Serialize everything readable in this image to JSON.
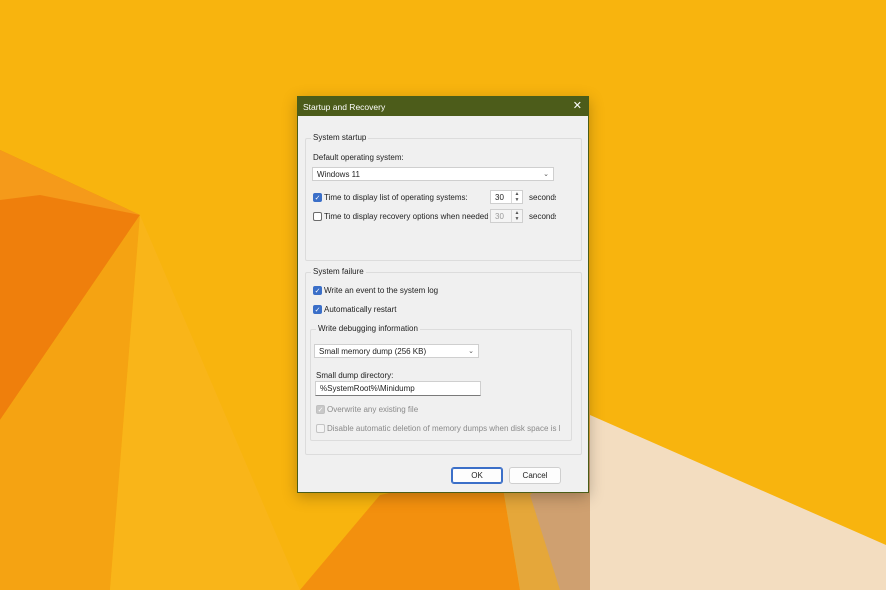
{
  "dialog": {
    "title": "Startup and Recovery",
    "close_glyph": "✕",
    "system_startup": {
      "group_label": "System startup",
      "default_os_label": "Default operating system:",
      "default_os_value": "Windows 11",
      "time_list": {
        "checked": true,
        "label": "Time to display list of operating systems:",
        "value": "30",
        "unit": "seconds"
      },
      "time_recovery": {
        "checked": false,
        "label": "Time to display recovery options when needed:",
        "value": "30",
        "unit": "seconds"
      }
    },
    "system_failure": {
      "group_label": "System failure",
      "write_event": {
        "checked": true,
        "label": "Write an event to the system log"
      },
      "auto_restart": {
        "checked": true,
        "label": "Automatically restart"
      },
      "debug": {
        "group_label": "Write debugging information",
        "dump_type": "Small memory dump (256 KB)",
        "dir_label": "Small dump directory:",
        "dir_value": "%SystemRoot%\\Minidump",
        "overwrite": {
          "checked": true,
          "enabled": false,
          "label": "Overwrite any existing file"
        },
        "disable_delete": {
          "checked": false,
          "enabled": false,
          "label": "Disable automatic deletion of memory dumps when disk space is l"
        }
      }
    },
    "ok_label": "OK",
    "cancel_label": "Cancel"
  },
  "colors": {
    "titlebar": "#4c5c1a",
    "checkbox_accent": "#3b6fc8",
    "wallpaper_yellow": "#f8b40e",
    "wallpaper_orange": "#ef7f0c"
  }
}
